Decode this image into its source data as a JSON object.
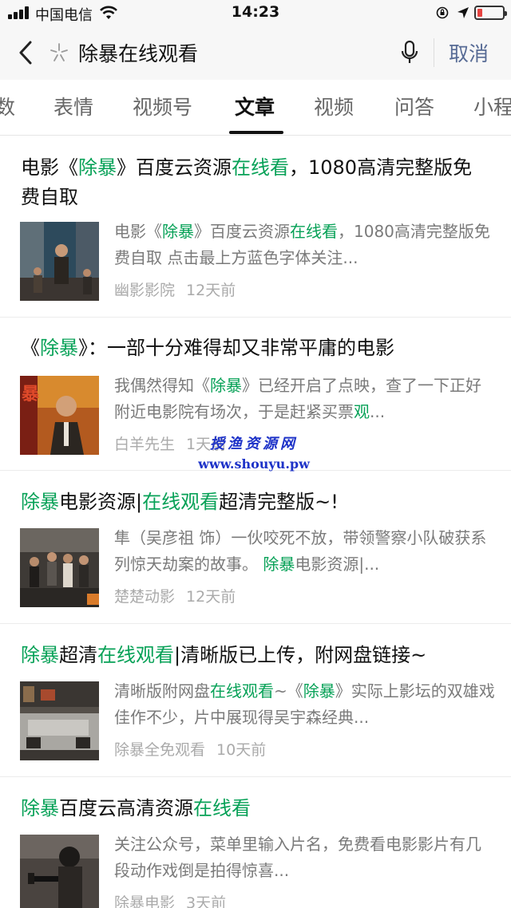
{
  "status_bar": {
    "carrier": "中国电信",
    "time": "14:23"
  },
  "search": {
    "query": "除暴在线观看",
    "cancel_label": "取消"
  },
  "tabs": [
    {
      "label": "数"
    },
    {
      "label": "表情"
    },
    {
      "label": "视频号"
    },
    {
      "label": "文章",
      "active": true
    },
    {
      "label": "视频"
    },
    {
      "label": "问答"
    },
    {
      "label": "小程"
    }
  ],
  "results": [
    {
      "title": [
        {
          "t": "电影《"
        },
        {
          "t": "除暴",
          "hl": true
        },
        {
          "t": "》百度云资源"
        },
        {
          "t": "在线看",
          "hl": true
        },
        {
          "t": "，1080高清完整版免费自取"
        }
      ],
      "snippet": [
        {
          "t": "电影《"
        },
        {
          "t": "除暴",
          "hl": true
        },
        {
          "t": "》百度云资源"
        },
        {
          "t": "在线看",
          "hl": true
        },
        {
          "t": "，1080高清完整版免费自取 点击最上方蓝色字体关注..."
        }
      ],
      "source": "幽影影院",
      "time": "12天前"
    },
    {
      "title": [
        {
          "t": "《"
        },
        {
          "t": "除暴",
          "hl": true
        },
        {
          "t": "》：一部十分难得却又非常平庸的电影"
        }
      ],
      "snippet": [
        {
          "t": "我偶然得知《"
        },
        {
          "t": "除暴",
          "hl": true
        },
        {
          "t": "》已经开启了点映，查了一下正好附近电影院有场次，于是赶紧买票"
        },
        {
          "t": "观",
          "hl": true
        },
        {
          "t": "..."
        }
      ],
      "source": "白羊先生",
      "time": "1天前"
    },
    {
      "title": [
        {
          "t": "除暴",
          "hl": true
        },
        {
          "t": "电影资源|"
        },
        {
          "t": "在线观看",
          "hl": true
        },
        {
          "t": "超清完整版~!"
        }
      ],
      "snippet": [
        {
          "t": "隼（吴彦祖 饰）一伙咬死不放，带领警察小队破获系列惊天劫案的故事。 "
        },
        {
          "t": "除暴",
          "hl": true
        },
        {
          "t": "电影资源|..."
        }
      ],
      "source": "楚楚动影",
      "time": "12天前"
    },
    {
      "title": [
        {
          "t": "除暴",
          "hl": true
        },
        {
          "t": "超清"
        },
        {
          "t": "在线观看",
          "hl": true
        },
        {
          "t": "|清晰版已上传，附网盘链接~"
        }
      ],
      "snippet": [
        {
          "t": "清晰版附网盘"
        },
        {
          "t": "在线观看",
          "hl": true
        },
        {
          "t": "~《"
        },
        {
          "t": "除暴",
          "hl": true
        },
        {
          "t": "》实际上影坛的双雄戏佳作不少，片中展现得吴宇森经典..."
        }
      ],
      "source": "除暴全免观看",
      "time": "10天前"
    },
    {
      "title": [
        {
          "t": "除暴",
          "hl": true
        },
        {
          "t": "百度云高清资源"
        },
        {
          "t": "在线看",
          "hl": true
        }
      ],
      "snippet": [
        {
          "t": "关注公众号，菜单里输入片名，免费看电影影片有几段动作戏倒是拍得惊喜..."
        }
      ],
      "source": "除暴电影",
      "time": "3天前"
    }
  ],
  "watermark": {
    "title": "授渔资源网",
    "url": "www.shouyu.pw"
  },
  "colors": {
    "highlight": "#07a157",
    "cancel": "#576b95",
    "meta": "#aaaaaa"
  }
}
